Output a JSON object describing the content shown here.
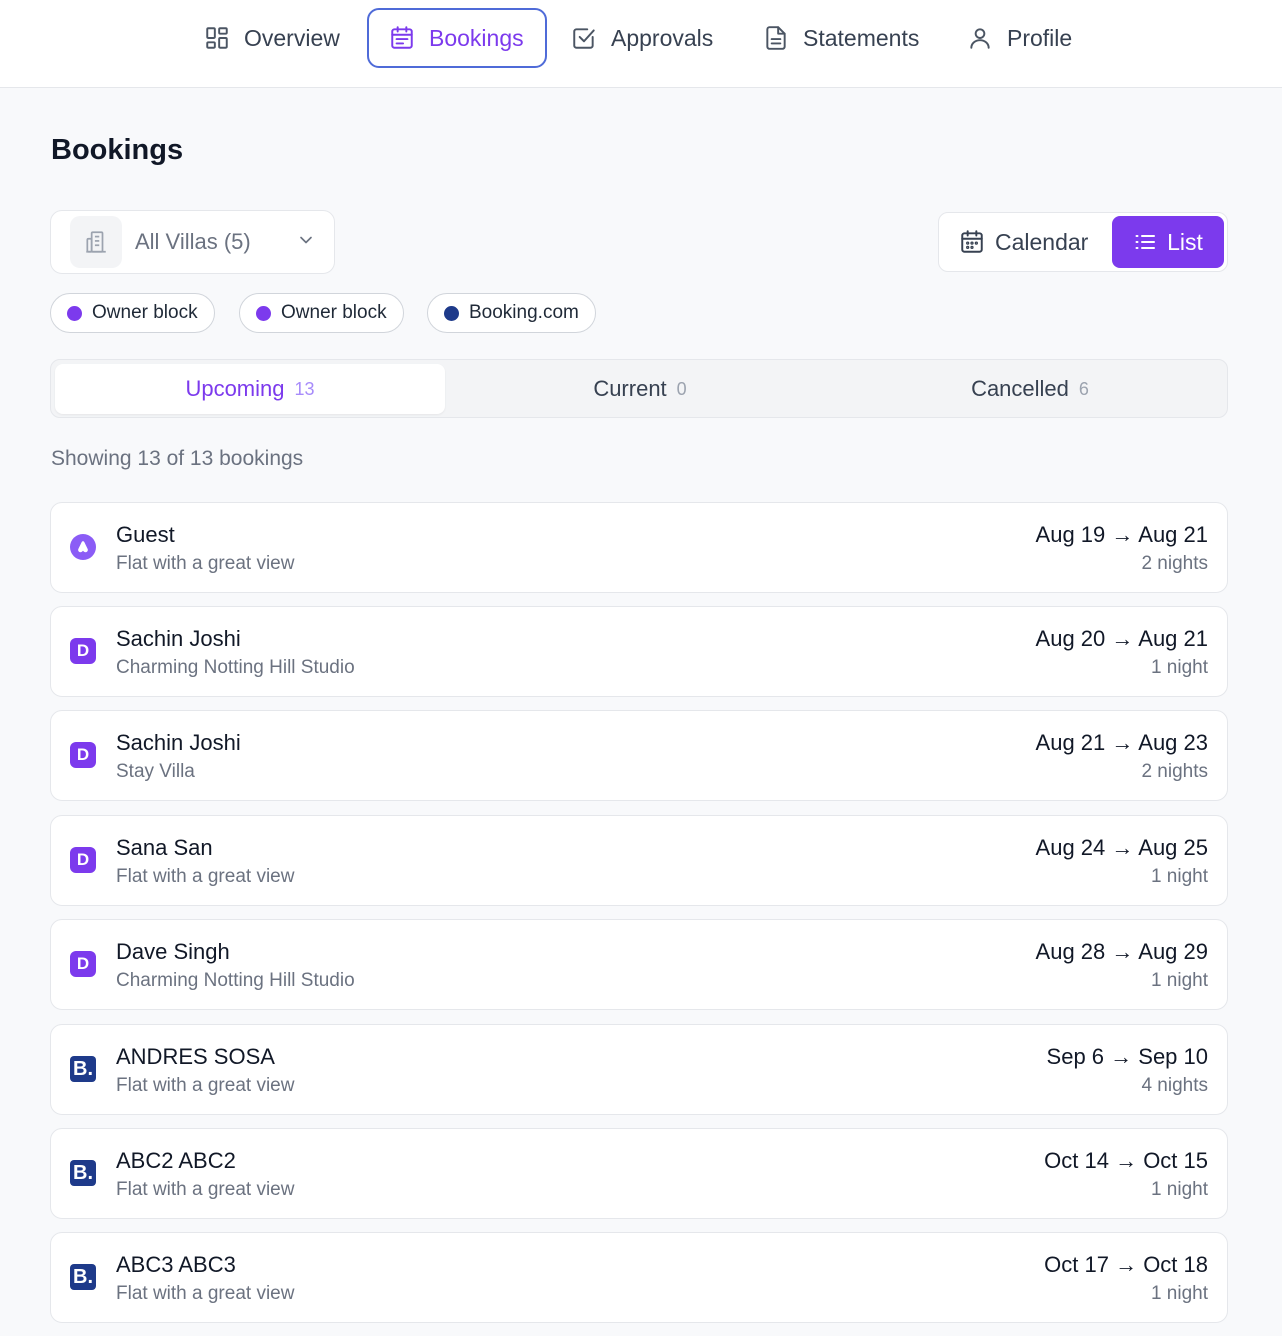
{
  "nav": {
    "items": [
      {
        "label": "Overview",
        "icon": "grid-icon"
      },
      {
        "label": "Bookings",
        "icon": "calendar-icon",
        "active": true
      },
      {
        "label": "Approvals",
        "icon": "check-square-icon"
      },
      {
        "label": "Statements",
        "icon": "document-icon"
      },
      {
        "label": "Profile",
        "icon": "user-icon"
      }
    ]
  },
  "page": {
    "title": "Bookings"
  },
  "filter": {
    "villa_label": "All Villas (5)"
  },
  "view_toggle": {
    "calendar_label": "Calendar",
    "list_label": "List",
    "selected": "List"
  },
  "legend": [
    {
      "label": "Owner block",
      "color": "#7c3aed"
    },
    {
      "label": "Owner block",
      "color": "#7c3aed"
    },
    {
      "label": "Booking.com",
      "color": "#1e3a8a"
    }
  ],
  "tabs": [
    {
      "label": "Upcoming",
      "count": "13",
      "active": true
    },
    {
      "label": "Current",
      "count": "0"
    },
    {
      "label": "Cancelled",
      "count": "6"
    }
  ],
  "summary": {
    "showing_text": "Showing 13 of 13 bookings"
  },
  "bookings": [
    {
      "guest": "Guest",
      "property": "Flat with a great view",
      "dates": "Aug 19 → Aug 21",
      "nights": "2 nights",
      "source": "airbnb"
    },
    {
      "guest": "Sachin Joshi",
      "property": "Charming Notting Hill Studio",
      "dates": "Aug 20 → Aug 21",
      "nights": "1 night",
      "source": "direct",
      "source_letter": "D"
    },
    {
      "guest": "Sachin Joshi",
      "property": "Stay Villa",
      "dates": "Aug 21 → Aug 23",
      "nights": "2 nights",
      "source": "direct",
      "source_letter": "D"
    },
    {
      "guest": "Sana San",
      "property": "Flat with a great view",
      "dates": "Aug 24 → Aug 25",
      "nights": "1 night",
      "source": "direct",
      "source_letter": "D"
    },
    {
      "guest": "Dave Singh",
      "property": "Charming Notting Hill Studio",
      "dates": "Aug 28 → Aug 29",
      "nights": "1 night",
      "source": "direct",
      "source_letter": "D"
    },
    {
      "guest": "ANDRES SOSA",
      "property": "Flat with a great view",
      "dates": "Sep 6 → Sep 10",
      "nights": "4 nights",
      "source": "booking",
      "source_letter": "B."
    },
    {
      "guest": "ABC2 ABC2",
      "property": "Flat with a great view",
      "dates": "Oct 14 → Oct 15",
      "nights": "1 night",
      "source": "booking",
      "source_letter": "B."
    },
    {
      "guest": "ABC3 ABC3",
      "property": "Flat with a great view",
      "dates": "Oct 17 → Oct 18",
      "nights": "1 night",
      "source": "booking",
      "source_letter": "B."
    }
  ]
}
